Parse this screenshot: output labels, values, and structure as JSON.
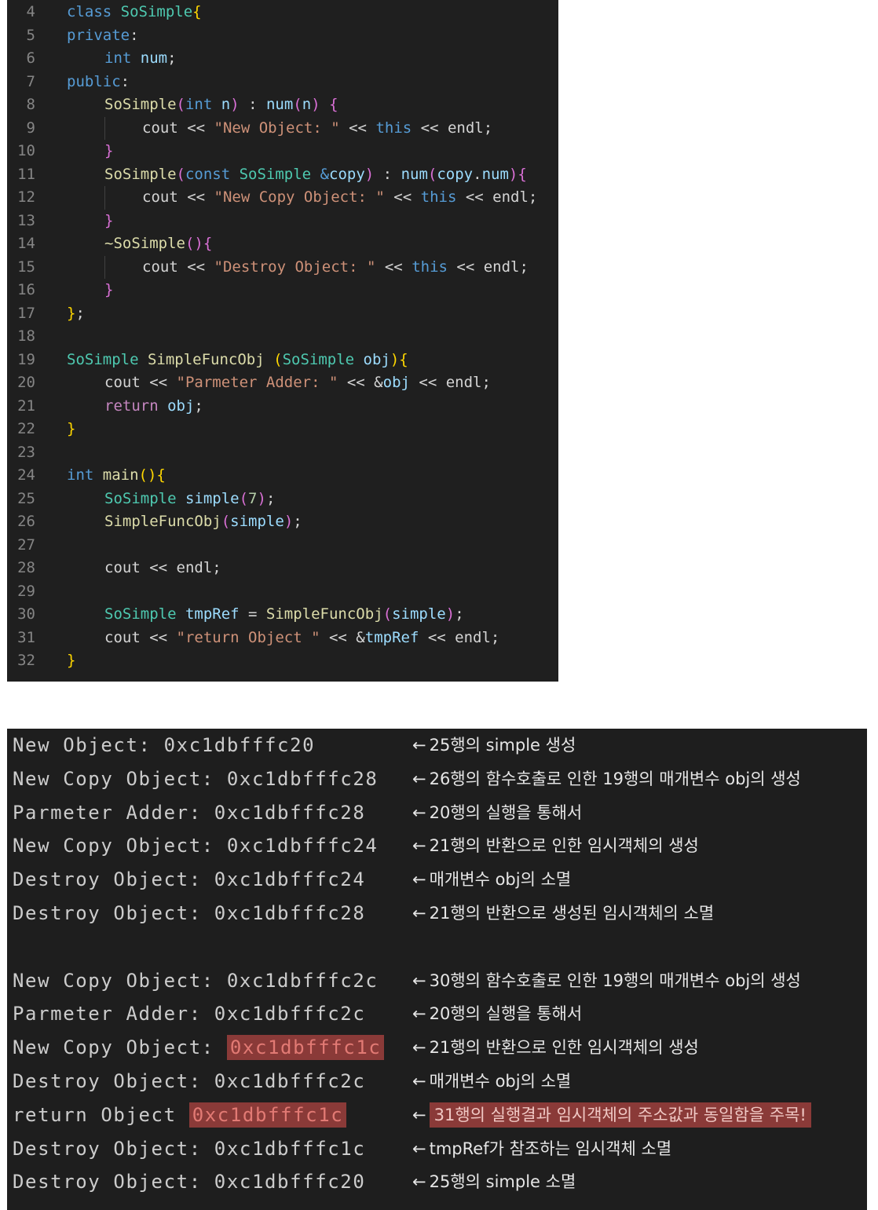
{
  "editor": {
    "lines": [
      {
        "n": "4",
        "indent": 0,
        "segs": [
          [
            "kw",
            "class "
          ],
          [
            "ty",
            "SoSimple"
          ],
          [
            "b1",
            "{"
          ]
        ]
      },
      {
        "n": "5",
        "indent": 0,
        "segs": [
          [
            "kw",
            "private"
          ],
          [
            "pl",
            ":"
          ]
        ]
      },
      {
        "n": "6",
        "indent": 1,
        "segs": [
          [
            "kw",
            "int "
          ],
          [
            "va",
            "num"
          ],
          [
            "pl",
            ";"
          ]
        ]
      },
      {
        "n": "7",
        "indent": 0,
        "segs": [
          [
            "kw",
            "public"
          ],
          [
            "pl",
            ":"
          ]
        ]
      },
      {
        "n": "8",
        "indent": 1,
        "segs": [
          [
            "fn",
            "SoSimple"
          ],
          [
            "b2",
            "("
          ],
          [
            "kw",
            "int "
          ],
          [
            "va",
            "n"
          ],
          [
            "b2",
            ")"
          ],
          [
            "pl",
            " : "
          ],
          [
            "va",
            "num"
          ],
          [
            "b2",
            "("
          ],
          [
            "va",
            "n"
          ],
          [
            "b2",
            ")"
          ],
          [
            "pl",
            " "
          ],
          [
            "b2",
            "{"
          ]
        ]
      },
      {
        "n": "9",
        "indent": 2,
        "segs": [
          [
            "pl",
            "cout << "
          ],
          [
            "st",
            "\"New Object: \""
          ],
          [
            "pl",
            " << "
          ],
          [
            "kw",
            "this"
          ],
          [
            "pl",
            " << endl;"
          ]
        ]
      },
      {
        "n": "10",
        "indent": 1,
        "segs": [
          [
            "b2",
            "}"
          ]
        ]
      },
      {
        "n": "11",
        "indent": 1,
        "segs": [
          [
            "fn",
            "SoSimple"
          ],
          [
            "b2",
            "("
          ],
          [
            "kw",
            "const "
          ],
          [
            "ty",
            "SoSimple "
          ],
          [
            "kw",
            "&"
          ],
          [
            "va",
            "copy"
          ],
          [
            "b2",
            ")"
          ],
          [
            "pl",
            " : "
          ],
          [
            "va",
            "num"
          ],
          [
            "b2",
            "("
          ],
          [
            "va",
            "copy"
          ],
          [
            "pl",
            "."
          ],
          [
            "va",
            "num"
          ],
          [
            "b2",
            ")"
          ],
          [
            "b2",
            "{"
          ]
        ]
      },
      {
        "n": "12",
        "indent": 2,
        "segs": [
          [
            "pl",
            "cout << "
          ],
          [
            "st",
            "\"New Copy Object: \""
          ],
          [
            "pl",
            " << "
          ],
          [
            "kw",
            "this"
          ],
          [
            "pl",
            " << endl;"
          ]
        ]
      },
      {
        "n": "13",
        "indent": 1,
        "segs": [
          [
            "b2",
            "}"
          ]
        ]
      },
      {
        "n": "14",
        "indent": 1,
        "segs": [
          [
            "fn",
            "~SoSimple"
          ],
          [
            "b2",
            "()"
          ],
          [
            "b2",
            "{"
          ]
        ]
      },
      {
        "n": "15",
        "indent": 2,
        "segs": [
          [
            "pl",
            "cout << "
          ],
          [
            "st",
            "\"Destroy Object: \""
          ],
          [
            "pl",
            " << "
          ],
          [
            "kw",
            "this"
          ],
          [
            "pl",
            " << endl;"
          ]
        ]
      },
      {
        "n": "16",
        "indent": 1,
        "segs": [
          [
            "b2",
            "}"
          ]
        ]
      },
      {
        "n": "17",
        "indent": 0,
        "segs": [
          [
            "b1",
            "}"
          ],
          [
            "pl",
            ";"
          ]
        ]
      },
      {
        "n": "18",
        "indent": 0,
        "segs": []
      },
      {
        "n": "19",
        "indent": 0,
        "segs": [
          [
            "ty",
            "SoSimple "
          ],
          [
            "fn",
            "SimpleFuncObj "
          ],
          [
            "b1",
            "("
          ],
          [
            "ty",
            "SoSimple "
          ],
          [
            "va",
            "obj"
          ],
          [
            "b1",
            ")"
          ],
          [
            "b1",
            "{"
          ]
        ]
      },
      {
        "n": "20",
        "indent": 1,
        "segs": [
          [
            "pl",
            "cout << "
          ],
          [
            "st",
            "\"Parmeter Adder: \""
          ],
          [
            "pl",
            " << &"
          ],
          [
            "va",
            "obj"
          ],
          [
            "pl",
            " << endl;"
          ]
        ]
      },
      {
        "n": "21",
        "indent": 1,
        "segs": [
          [
            "ct",
            "return "
          ],
          [
            "va",
            "obj"
          ],
          [
            "pl",
            ";"
          ]
        ]
      },
      {
        "n": "22",
        "indent": 0,
        "segs": [
          [
            "b1",
            "}"
          ]
        ]
      },
      {
        "n": "23",
        "indent": 0,
        "segs": []
      },
      {
        "n": "24",
        "indent": 0,
        "segs": [
          [
            "kw",
            "int "
          ],
          [
            "fn",
            "main"
          ],
          [
            "b1",
            "()"
          ],
          [
            "b1",
            "{"
          ]
        ]
      },
      {
        "n": "25",
        "indent": 1,
        "segs": [
          [
            "ty",
            "SoSimple "
          ],
          [
            "va",
            "simple"
          ],
          [
            "b2",
            "("
          ],
          [
            "nu",
            "7"
          ],
          [
            "b2",
            ")"
          ],
          [
            "pl",
            ";"
          ]
        ]
      },
      {
        "n": "26",
        "indent": 1,
        "segs": [
          [
            "fn",
            "SimpleFuncObj"
          ],
          [
            "b2",
            "("
          ],
          [
            "va",
            "simple"
          ],
          [
            "b2",
            ")"
          ],
          [
            "pl",
            ";"
          ]
        ]
      },
      {
        "n": "27",
        "indent": 0,
        "segs": []
      },
      {
        "n": "28",
        "indent": 1,
        "segs": [
          [
            "pl",
            "cout << endl;"
          ]
        ]
      },
      {
        "n": "29",
        "indent": 0,
        "segs": []
      },
      {
        "n": "30",
        "indent": 1,
        "segs": [
          [
            "ty",
            "SoSimple "
          ],
          [
            "va",
            "tmpRef"
          ],
          [
            "pl",
            " = "
          ],
          [
            "fn",
            "SimpleFuncObj"
          ],
          [
            "b2",
            "("
          ],
          [
            "va",
            "simple"
          ],
          [
            "b2",
            ")"
          ],
          [
            "pl",
            ";"
          ]
        ]
      },
      {
        "n": "31",
        "indent": 1,
        "segs": [
          [
            "pl",
            "cout << "
          ],
          [
            "st",
            "\"return Object \""
          ],
          [
            "pl",
            " << &"
          ],
          [
            "va",
            "tmpRef"
          ],
          [
            "pl",
            " << endl;"
          ]
        ]
      },
      {
        "n": "32",
        "indent": 0,
        "segs": [
          [
            "b1",
            "}"
          ]
        ]
      }
    ]
  },
  "terminal": {
    "arrow": "←",
    "rows": [
      {
        "label": "New Object: ",
        "addr": "0xc1dbfffc20",
        "addr_hl": false,
        "note": "25행의 simple 생성",
        "note_hl": false
      },
      {
        "label": "New Copy Object: ",
        "addr": "0xc1dbfffc28",
        "addr_hl": false,
        "note": "26행의 함수호출로 인한 19행의 매개변수 obj의 생성",
        "note_hl": false
      },
      {
        "label": "Parmeter Adder: ",
        "addr": "0xc1dbfffc28",
        "addr_hl": false,
        "note": "20행의 실행을 통해서",
        "note_hl": false
      },
      {
        "label": "New Copy Object: ",
        "addr": "0xc1dbfffc24",
        "addr_hl": false,
        "note": "21행의 반환으로 인한 임시객체의 생성",
        "note_hl": false
      },
      {
        "label": "Destroy Object: ",
        "addr": "0xc1dbfffc24",
        "addr_hl": false,
        "note": "매개변수 obj의 소멸",
        "note_hl": false
      },
      {
        "label": "Destroy Object: ",
        "addr": "0xc1dbfffc28",
        "addr_hl": false,
        "note": "21행의 반환으로 생성된 임시객체의 소멸",
        "note_hl": false
      },
      null,
      {
        "label": "New Copy Object: ",
        "addr": "0xc1dbfffc2c",
        "addr_hl": false,
        "note": "30행의 함수호출로 인한 19행의 매개변수 obj의 생성",
        "note_hl": false
      },
      {
        "label": "Parmeter Adder: ",
        "addr": "0xc1dbfffc2c",
        "addr_hl": false,
        "note": "20행의 실행을 통해서",
        "note_hl": false
      },
      {
        "label": "New Copy Object: ",
        "addr": "0xc1dbfffc1c",
        "addr_hl": true,
        "note": "21행의 반환으로 인한 임시객체의 생성",
        "note_hl": false
      },
      {
        "label": "Destroy Object: ",
        "addr": "0xc1dbfffc2c",
        "addr_hl": false,
        "note": "매개변수 obj의 소멸",
        "note_hl": false
      },
      {
        "label": "return Object ",
        "addr": "0xc1dbfffc1c",
        "addr_hl": true,
        "note": "31행의 실행결과 임시객체의 주소값과 동일함을 주목!",
        "note_hl": true
      },
      {
        "label": "Destroy Object: ",
        "addr": "0xc1dbfffc1c",
        "addr_hl": false,
        "note": "tmpRef가 참조하는 임시객체 소멸",
        "note_hl": false
      },
      {
        "label": "Destroy Object: ",
        "addr": "0xc1dbfffc20",
        "addr_hl": false,
        "note": "25행의 simple 소멸",
        "note_hl": false
      }
    ]
  },
  "colors": {
    "editor_bg": "#1f1f1f",
    "terminal_bg": "#1e1e1e",
    "highlight_bg": "#8a3a38"
  }
}
